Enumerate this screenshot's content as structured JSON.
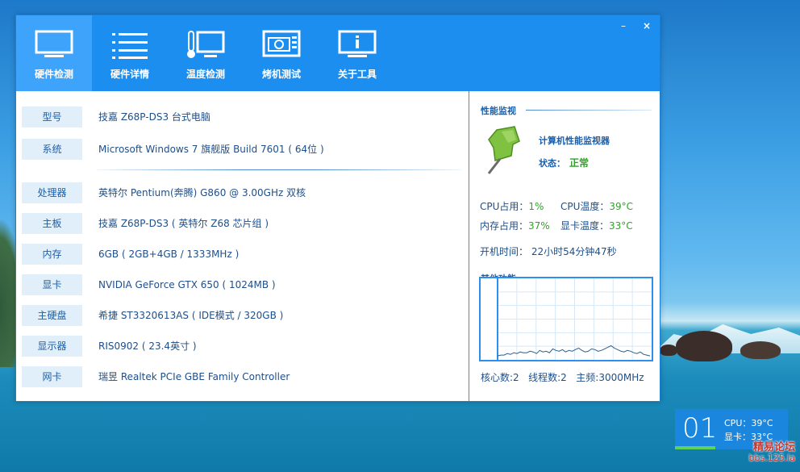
{
  "window": {
    "min_label": "–",
    "close_label": "×"
  },
  "tabs": [
    {
      "label": "硬件检测",
      "icon": "monitor-icon"
    },
    {
      "label": "硬件详情",
      "icon": "list-icon"
    },
    {
      "label": "温度检测",
      "icon": "thermometer-monitor-icon"
    },
    {
      "label": "烤机测试",
      "icon": "stress-test-icon"
    },
    {
      "label": "关于工具",
      "icon": "info-monitor-icon"
    }
  ],
  "hardware": [
    {
      "key": "型号",
      "value": "技嘉 Z68P-DS3 台式电脑"
    },
    {
      "key": "系统",
      "value": "Microsoft Windows 7 旗舰版 Build 7601 ( 64位 )"
    },
    {
      "key": "处理器",
      "value": "英特尔 Pentium(奔腾) G860 @ 3.00GHz 双核"
    },
    {
      "key": "主板",
      "value": "技嘉 Z68P-DS3 ( 英特尔 Z68 芯片组 )"
    },
    {
      "key": "内存",
      "value": "6GB ( 2GB+4GB / 1333MHz )"
    },
    {
      "key": "显卡",
      "value": "NVIDIA GeForce GTX 650 ( 1024MB )"
    },
    {
      "key": "主硬盘",
      "value": "希捷 ST3320613AS ( IDE模式 / 320GB )"
    },
    {
      "key": "显示器",
      "value": "RIS0902 ( 23.4英寸 )"
    },
    {
      "key": "网卡",
      "value": "瑞昱 Realtek PCIe GBE Family Controller"
    }
  ],
  "monitor": {
    "section_title": "性能监视",
    "title": "计算机性能监视器",
    "status_label": "状态：",
    "status_value": "正常",
    "cpu_usage_label": "CPU占用：",
    "cpu_usage": "1%",
    "cpu_temp_label": "CPU温度：",
    "cpu_temp": "39°C",
    "mem_usage_label": "内存占用：",
    "mem_usage": "37%",
    "gpu_temp_label": "显卡温度：",
    "gpu_temp": "33°C",
    "uptime": "开机时间： 22小时54分钟47秒",
    "other_title": "其他功能",
    "cores": "核心数:2",
    "threads": "线程数:2",
    "freq": "主频:3000MHz",
    "colors": {
      "ok": "#33a02c",
      "accent": "#1c8ef0"
    }
  },
  "chart_data": {
    "type": "line",
    "values": [
      3,
      4,
      4,
      6,
      5,
      7,
      6,
      8,
      7,
      7,
      9,
      8,
      6,
      10,
      8,
      9,
      7,
      12,
      10,
      9,
      11,
      8,
      10,
      9,
      11,
      13,
      10,
      8,
      9,
      12,
      11,
      9,
      10,
      12,
      14,
      16,
      13,
      11,
      9,
      8,
      10,
      9,
      7,
      6,
      8,
      5,
      4,
      3
    ]
  },
  "widget": {
    "number": "01",
    "cpu": "CPU：39°C",
    "gpu": "显卡：33°C"
  },
  "watermark": {
    "line1": "精易论坛",
    "line2": "bbs.125.la"
  }
}
